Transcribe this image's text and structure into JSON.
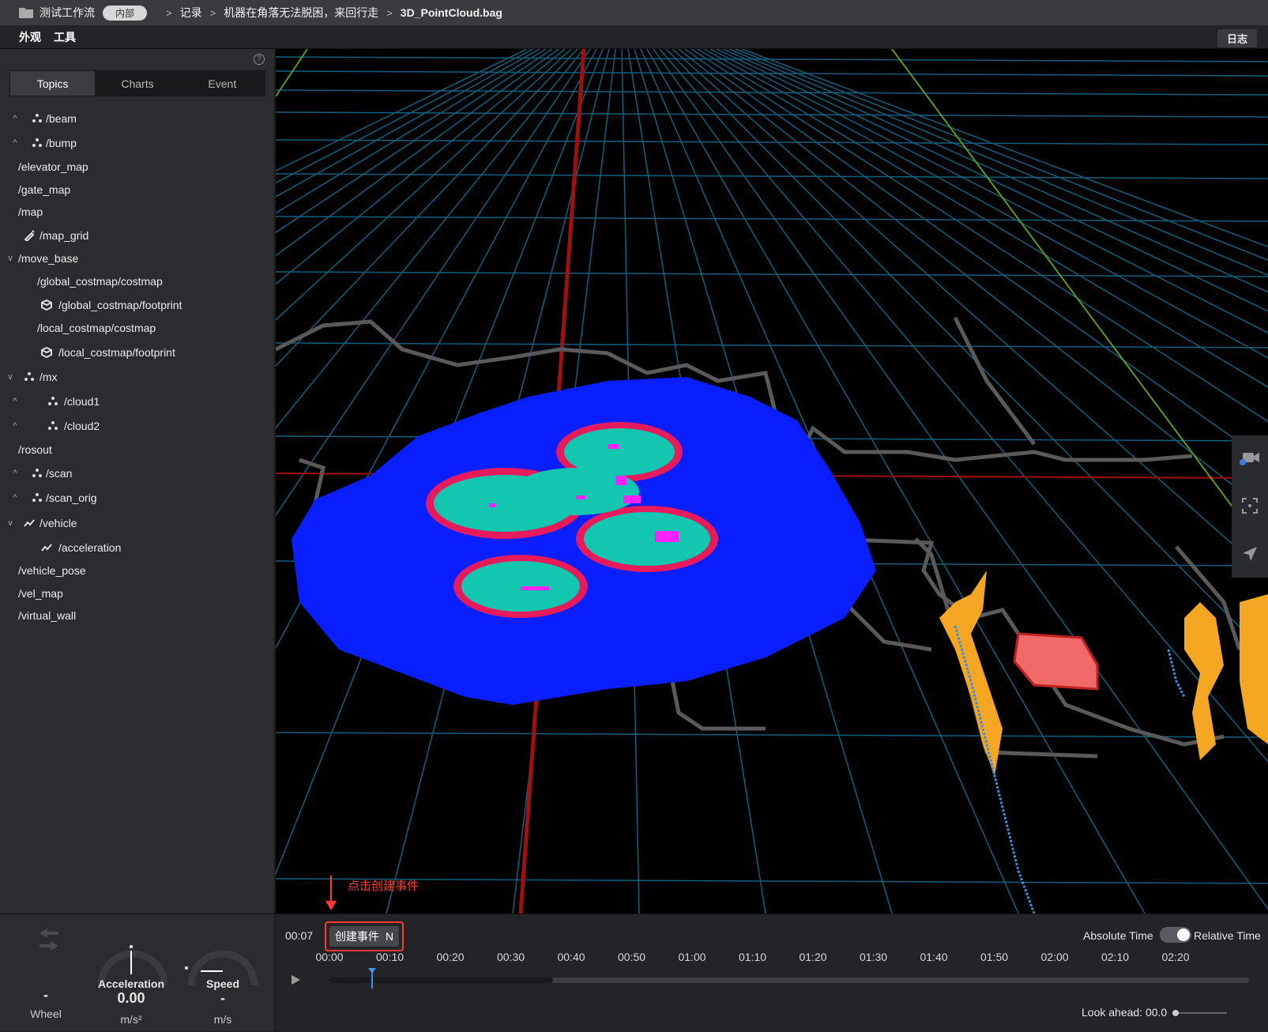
{
  "titlebar": {
    "folder_name": "测试工作流",
    "badge": "内部",
    "crumb1": "记录",
    "crumb2": "机器在角落无法脱困，来回行走",
    "crumb3": "3D_PointCloud.bag",
    "sep": ">"
  },
  "menubar": {
    "appearance": "外观",
    "tools": "工具",
    "log": "日志"
  },
  "sidebar": {
    "help": "?",
    "tabs": [
      "Topics",
      "Charts",
      "Event"
    ],
    "active_tab": "Topics",
    "topics": [
      {
        "label": "/beam",
        "icon": "points-icon",
        "chevron": "^"
      },
      {
        "label": "/bump",
        "icon": "points-icon",
        "chevron": "^"
      },
      {
        "label": "/elevator_map",
        "icon": "",
        "chevron": ""
      },
      {
        "label": "/gate_map",
        "icon": "",
        "chevron": ""
      },
      {
        "label": "/map",
        "icon": "",
        "chevron": ""
      },
      {
        "label": "/map_grid",
        "icon": "pen-icon",
        "chevron": ""
      },
      {
        "label": "/move_base",
        "icon": "",
        "chevron": "v"
      },
      {
        "label": "/global_costmap/costmap",
        "icon": "",
        "chevron": ""
      },
      {
        "label": "/global_costmap/footprint",
        "icon": "cube-icon",
        "chevron": ""
      },
      {
        "label": "/local_costmap/costmap",
        "icon": "",
        "chevron": ""
      },
      {
        "label": "/local_costmap/footprint",
        "icon": "cube-icon",
        "chevron": ""
      },
      {
        "label": "/mx",
        "icon": "points-icon",
        "chevron": "v"
      },
      {
        "label": "/cloud1",
        "icon": "points-icon",
        "chevron": "^"
      },
      {
        "label": "/cloud2",
        "icon": "points-icon",
        "chevron": "^"
      },
      {
        "label": "/rosout",
        "icon": "",
        "chevron": ""
      },
      {
        "label": "/scan",
        "icon": "points-icon",
        "chevron": "^"
      },
      {
        "label": "/scan_orig",
        "icon": "points-icon",
        "chevron": "^"
      },
      {
        "label": "/vehicle",
        "icon": "line-chart-icon",
        "chevron": "v"
      },
      {
        "label": "/acceleration",
        "icon": "line-chart-icon",
        "chevron": ""
      },
      {
        "label": "/vehicle_pose",
        "icon": "",
        "chevron": ""
      },
      {
        "label": "/vel_map",
        "icon": "",
        "chevron": ""
      },
      {
        "label": "/virtual_wall",
        "icon": "",
        "chevron": ""
      }
    ]
  },
  "annotation": {
    "text": "点击创建事件"
  },
  "gauges": {
    "wheel_value": "-",
    "wheel_label": "Wheel",
    "accel_label": "Acceleration",
    "accel_value": "0.00",
    "accel_unit": "m/s²",
    "speed_label": "Speed",
    "speed_value": "-",
    "speed_unit": "m/s"
  },
  "timeline": {
    "current_time": "00:07",
    "create_event_label": "创建事件",
    "create_event_shortcut": "N",
    "absolute_time": "Absolute Time",
    "relative_time": "Relative Time",
    "relative_time_enabled": true,
    "ticks": [
      "00:00",
      "00:10",
      "00:20",
      "00:30",
      "00:40",
      "00:50",
      "01:00",
      "01:10",
      "01:20",
      "01:30",
      "01:40",
      "01:50",
      "02:00",
      "02:10",
      "02:20"
    ],
    "playhead_seconds": 7,
    "buffered_seconds": 37,
    "tick_step_seconds": 10,
    "look_ahead_label": "Look ahead: 00.0",
    "look_ahead_value": 0.0
  },
  "colors": {
    "costmap_blue": "#0a1fff",
    "costmap_teal": "#12c6b0",
    "costmap_magenta": "#ff22ff",
    "obstacle_red": "#ff3b30",
    "footprint_fill": "#f06a6a",
    "pointcloud_orange": "#f5a623",
    "grid_blue": "#13607e",
    "axis_red": "#a01010",
    "axis_green": "#5a9a20",
    "playhead_blue": "#4a90e2"
  }
}
